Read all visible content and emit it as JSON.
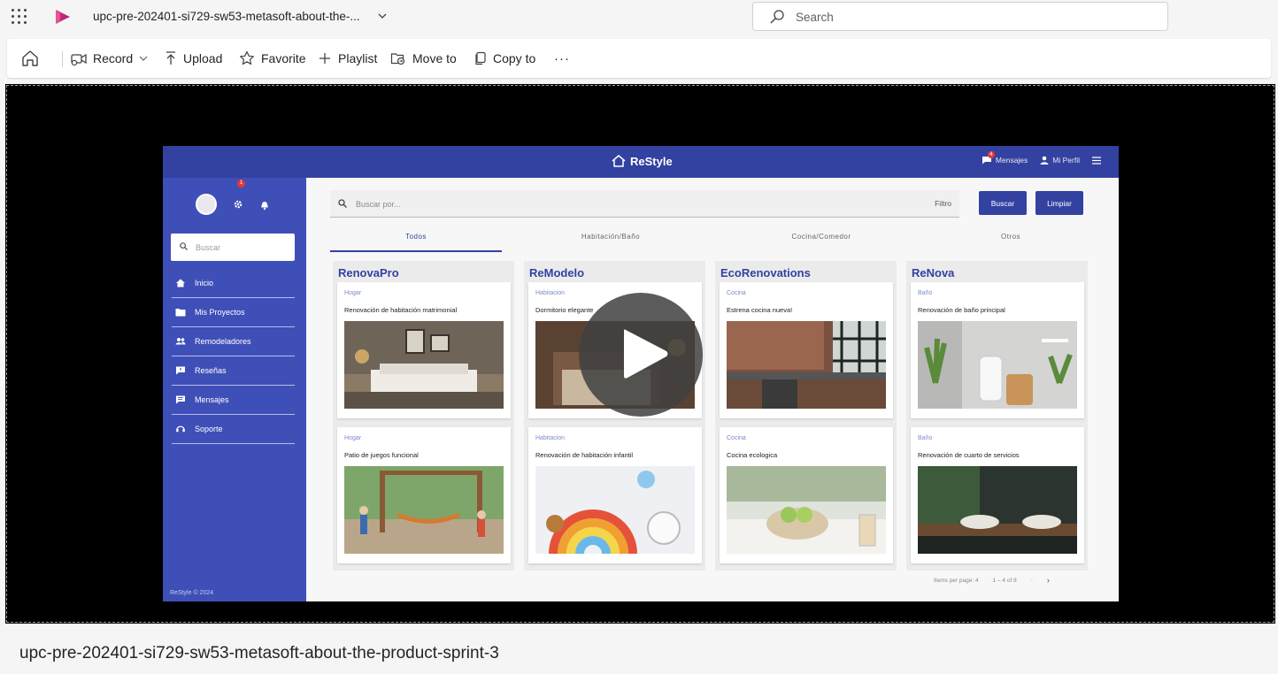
{
  "topbar": {
    "doc_title": "upc-pre-202401-si729-sw53-metasoft-about-the-...",
    "search_placeholder": "Search"
  },
  "commands": {
    "record": "Record",
    "upload": "Upload",
    "favorite": "Favorite",
    "playlist": "Playlist",
    "move_to": "Move to",
    "copy_to": "Copy to",
    "more": "···"
  },
  "video": {
    "name": "upc-pre-202401-si729-sw53-metasoft-about-the-product-sprint-3"
  },
  "app": {
    "brand": "ReStyle",
    "header_messages": "Mensajes",
    "header_profile": "Mi Perfil",
    "messages_badge": "4",
    "bell_badge": "1",
    "sidebar_search_placeholder": "Buscar",
    "nav": [
      "Inicio",
      "Mis Proyectos",
      "Remodeladores",
      "Reseñas",
      "Mensajes",
      "Soporte"
    ],
    "footer": "ReStyle © 2024",
    "search_placeholder": "Buscar por...",
    "filter_label": "Filtro",
    "search_button": "Buscar",
    "clear_button": "Limpiar",
    "tabs": [
      "Todos",
      "Habitación/Baño",
      "Cocina/Comedor",
      "Otros"
    ],
    "columns": [
      {
        "title": "RenovaPro",
        "cards": [
          {
            "category": "Hogar",
            "title": "Renovación de habitación matrimonial"
          },
          {
            "category": "Hogar",
            "title": "Patio de juegos funcional"
          }
        ]
      },
      {
        "title": "ReModelo",
        "cards": [
          {
            "category": "Habitacion",
            "title": "Dormitorio elegante"
          },
          {
            "category": "Habitacion",
            "title": "Renovación de habitación infantil"
          }
        ]
      },
      {
        "title": "EcoRenovations",
        "cards": [
          {
            "category": "Cocina",
            "title": "Estrena cocina nueva!"
          },
          {
            "category": "Cocina",
            "title": "Cocina ecologica"
          }
        ]
      },
      {
        "title": "ReNova",
        "cards": [
          {
            "category": "Baño",
            "title": "Renovación de baño principal"
          },
          {
            "category": "Baño",
            "title": "Renovación de cuarto de servicios"
          }
        ]
      }
    ],
    "pager_items_per_page": "Items per page: 4",
    "pager_range": "1 – 4 of 8"
  },
  "colors": {
    "app_primary": "#3341a0",
    "sidebar": "#3f4fb8",
    "player_bg": "#000000"
  }
}
